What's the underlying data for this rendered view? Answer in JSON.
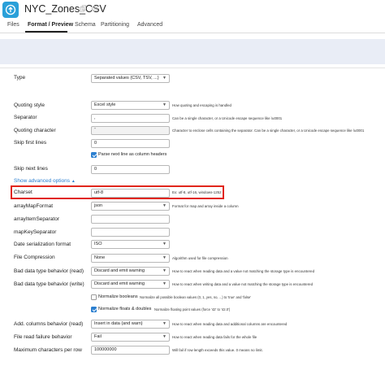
{
  "header": {
    "title": "NYC_Zones_CSV",
    "logo_icon": "arrow-up-circle-icon",
    "colors": {
      "logo": "#2aa0d9",
      "highlight": "#e1261c",
      "accent": "#2b7fd0"
    }
  },
  "tabs": [
    {
      "label": "Files"
    },
    {
      "label": "Format / Preview"
    },
    {
      "label": "Schema"
    },
    {
      "label": "Partitioning"
    },
    {
      "label": "Advanced"
    }
  ],
  "form": {
    "type": {
      "label": "Type",
      "value": "Separated values (CSV, TSV, ...)"
    },
    "quoting_style": {
      "label": "Quoting style",
      "value": "Excel style",
      "help": "How quoting and escaping is handled"
    },
    "separator": {
      "label": "Separator",
      "value": ",",
      "help": "Can be a single character, or a Unicode escape sequence like \\u0001"
    },
    "quoting_character": {
      "label": "Quoting character",
      "value": "\"",
      "help": "Character to enclose cells containing the separator. Can be a single character, or a Unicode escape sequence like \\u0001"
    },
    "skip_first_lines": {
      "label": "Skip first lines",
      "value": "0"
    },
    "parse_next_line": {
      "label": "Parse next line as column headers",
      "checked": true
    },
    "skip_next_lines": {
      "label": "Skip next lines",
      "value": "0"
    },
    "show_advanced": "Show advanced options",
    "charset": {
      "label": "Charset",
      "value": "utf-8",
      "help": "Ex: utf-8, utf-16, windows-1252"
    },
    "array_map_format": {
      "label": "arrayMapFormat",
      "value": "json",
      "help": "Format for map and array inside a column"
    },
    "array_item_separator": {
      "label": "arrayItemSeparator"
    },
    "map_key_separator": {
      "label": "mapKeySeparator"
    },
    "date_serialization_format": {
      "label": "Date serialization format",
      "value": "ISO"
    },
    "file_compression": {
      "label": "File Compression",
      "value": "None",
      "help": "Algorithm used for file compression"
    },
    "bad_type_read": {
      "label": "Bad data type behavior (read)",
      "value": "Discard and emit warning",
      "help": "How to react when reading data and a value not matching the storage type is encountered"
    },
    "bad_type_write": {
      "label": "Bad data type behavior (write)",
      "value": "Discard and emit warning",
      "help": "How to react when writing data and a value not matching the storage type is encountered"
    },
    "normalize_booleans": {
      "label": "Normalize booleans",
      "checked": false,
      "help": "Normalize all possible boolean values (0, 1, yes, no, ...) to 'true' and 'false'"
    },
    "normalize_floats": {
      "label": "Normalize floats & doubles",
      "checked": true,
      "help": "Normalize floating point values (force '42' to '42.0')"
    },
    "add_columns_read": {
      "label": "Add. columns behavior (read)",
      "value": "Insert in data (and warn)",
      "help": "How to react when reading data and additional columns are encountered"
    },
    "file_read_failure": {
      "label": "File read failure behavior",
      "value": "Fail",
      "help": "How to react when reading data fails for the whole file"
    },
    "max_chars_per_row": {
      "label": "Maximum characters per row",
      "value": "100000000",
      "help": "Will fail if row length exceeds this value. 0 means no limit."
    }
  }
}
